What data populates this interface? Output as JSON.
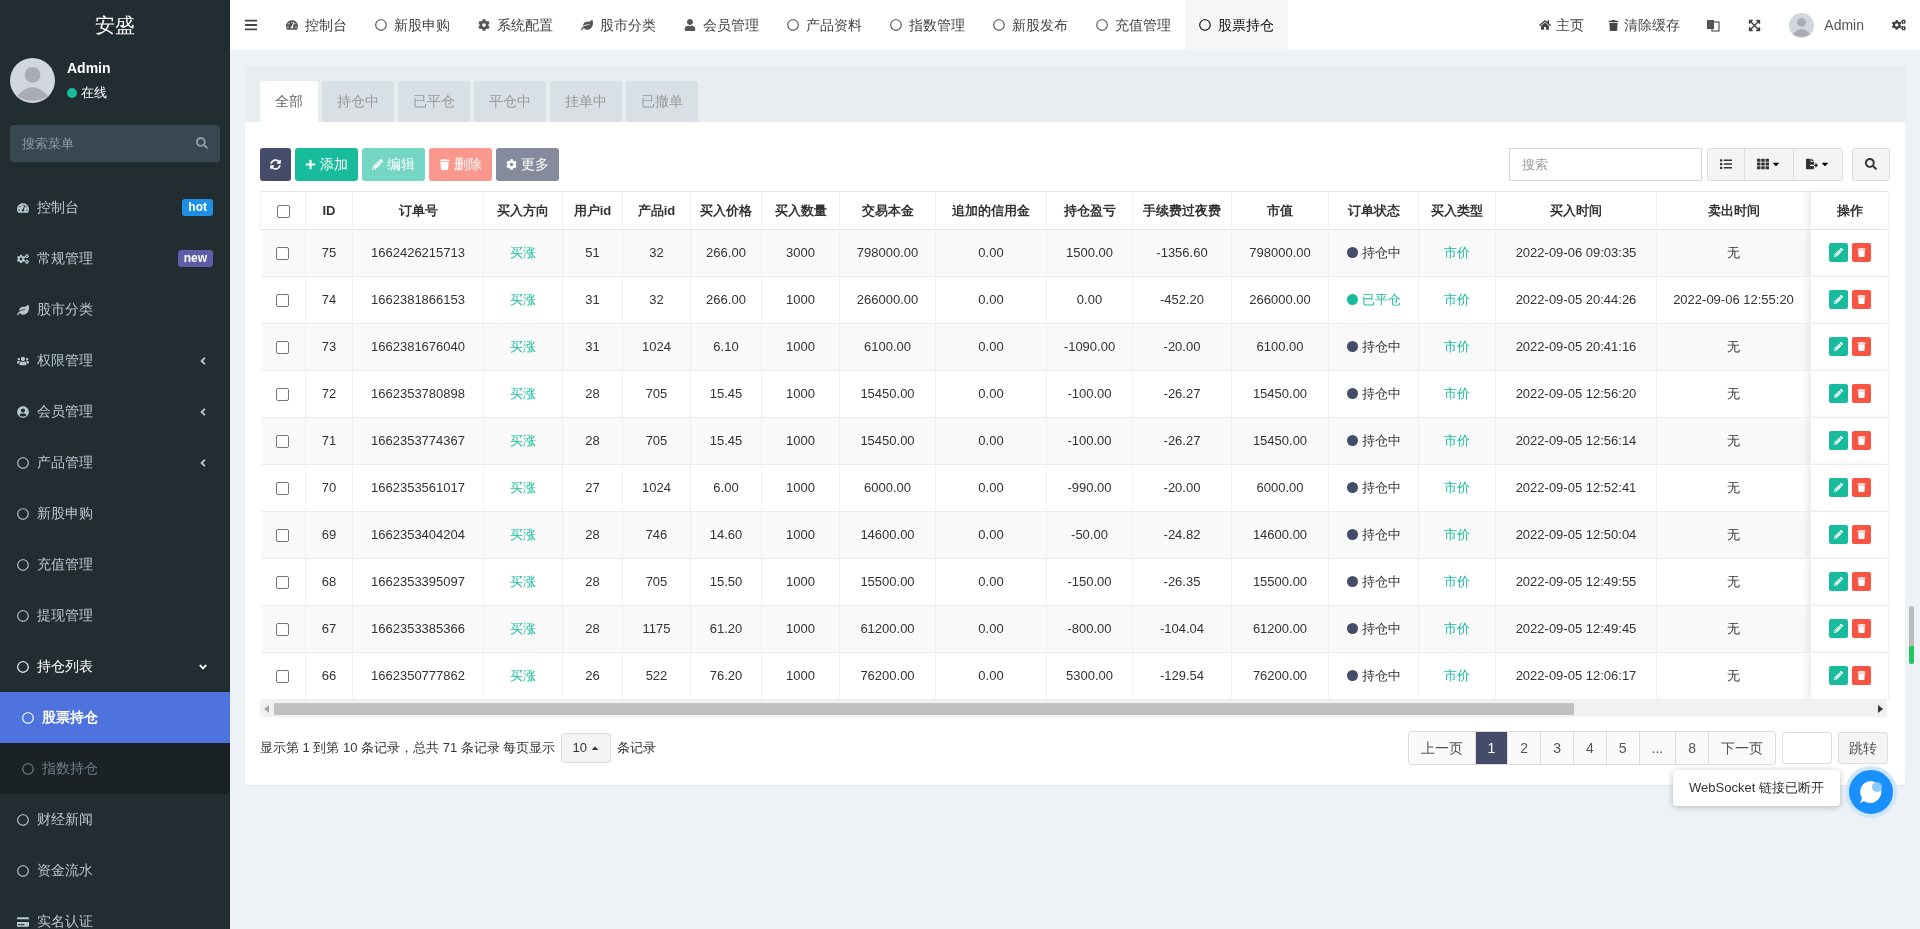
{
  "sidebar": {
    "logo": "安盛",
    "user": {
      "name": "Admin",
      "status": "在线"
    },
    "search": {
      "placeholder": "搜索菜单"
    },
    "items": [
      {
        "label": "控制台",
        "badge": {
          "label": "hot",
          "color": "#1e8fe6"
        },
        "selected": false
      },
      {
        "label": "常规管理",
        "badge": {
          "label": "new",
          "color": "#605ca8"
        },
        "selected": false
      },
      {
        "label": "股市分类",
        "selected": false
      },
      {
        "label": "权限管理",
        "expanded": false,
        "selected": false
      },
      {
        "label": "会员管理",
        "expanded": false,
        "selected": false
      },
      {
        "label": "产品管理",
        "expanded": false,
        "selected": false
      },
      {
        "label": "新股申购",
        "selected": false
      },
      {
        "label": "充值管理",
        "selected": false
      },
      {
        "label": "提现管理",
        "selected": false
      },
      {
        "label": "持仓列表",
        "expanded": true,
        "selected": false,
        "children": [
          {
            "label": "股票持仓",
            "selected": true
          },
          {
            "label": "指数持仓",
            "selected": false
          }
        ]
      },
      {
        "label": "财经新闻",
        "selected": false
      },
      {
        "label": "资金流水",
        "selected": false
      },
      {
        "label": "实名认证",
        "selected": false
      }
    ]
  },
  "topnav": {
    "tabs": [
      {
        "label": "控制台",
        "selected": false
      },
      {
        "label": "新股申购",
        "selected": false
      },
      {
        "label": "系统配置",
        "selected": false
      },
      {
        "label": "股市分类",
        "selected": false
      },
      {
        "label": "会员管理",
        "selected": false
      },
      {
        "label": "产品资料",
        "selected": false
      },
      {
        "label": "指数管理",
        "selected": false
      },
      {
        "label": "新股发布",
        "selected": false
      },
      {
        "label": "充值管理",
        "selected": false
      },
      {
        "label": "股票持仓",
        "selected": true
      }
    ],
    "links": [
      "主页",
      "清除缓存"
    ],
    "user": "Admin"
  },
  "filter_tabs": [
    {
      "label": "全部",
      "selected": true
    },
    {
      "label": "持仓中",
      "selected": false
    },
    {
      "label": "已平仓",
      "selected": false
    },
    {
      "label": "平仓中",
      "selected": false
    },
    {
      "label": "挂单中",
      "selected": false
    },
    {
      "label": "已撤单",
      "selected": false
    }
  ],
  "toolbar": {
    "buttons": [
      {
        "kind": "refresh",
        "disabled": false
      },
      {
        "kind": "add",
        "label": "添加",
        "disabled": false
      },
      {
        "kind": "edit",
        "label": "编辑",
        "disabled": true
      },
      {
        "kind": "delete",
        "label": "删除",
        "disabled": true
      },
      {
        "kind": "more",
        "label": "更多",
        "disabled": false
      }
    ],
    "search": {
      "placeholder": "搜索"
    }
  },
  "table": {
    "select_all": {
      "checked": false
    },
    "columns": [
      "ID",
      "订单号",
      "买入方向",
      "用户id",
      "产品id",
      "买入价格",
      "买入数量",
      "交易本金",
      "追加的信用金",
      "持仓盈亏",
      "手续费过夜费",
      "市值",
      "订单状态",
      "买入类型",
      "买入时间",
      "卖出时间",
      "操作"
    ],
    "rows": [
      {
        "checked": false,
        "cells": [
          "75",
          "1662426215713",
          "买涨",
          "51",
          "32",
          "266.00",
          "3000",
          "798000.00",
          "0.00",
          "1500.00",
          "-1356.60",
          "798000.00"
        ],
        "status": {
          "label": "持仓中",
          "color": "#444c69"
        },
        "buy_type": "市价",
        "buy_time": "2022-09-06 09:03:35",
        "sell_time": "无"
      },
      {
        "checked": false,
        "cells": [
          "74",
          "1662381866153",
          "买涨",
          "31",
          "32",
          "266.00",
          "1000",
          "266000.00",
          "0.00",
          "0.00",
          "-452.20",
          "266000.00"
        ],
        "status": {
          "label": "已平仓",
          "color": "#18bc9c"
        },
        "buy_type": "市价",
        "buy_time": "2022-09-05 20:44:26",
        "sell_time": "2022-09-06 12:55:20"
      },
      {
        "checked": false,
        "cells": [
          "73",
          "1662381676040",
          "买涨",
          "31",
          "1024",
          "6.10",
          "1000",
          "6100.00",
          "0.00",
          "-1090.00",
          "-20.00",
          "6100.00"
        ],
        "status": {
          "label": "持仓中",
          "color": "#444c69"
        },
        "buy_type": "市价",
        "buy_time": "2022-09-05 20:41:16",
        "sell_time": "无"
      },
      {
        "checked": false,
        "cells": [
          "72",
          "1662353780898",
          "买涨",
          "28",
          "705",
          "15.45",
          "1000",
          "15450.00",
          "0.00",
          "-100.00",
          "-26.27",
          "15450.00"
        ],
        "status": {
          "label": "持仓中",
          "color": "#444c69"
        },
        "buy_type": "市价",
        "buy_time": "2022-09-05 12:56:20",
        "sell_time": "无"
      },
      {
        "checked": false,
        "cells": [
          "71",
          "1662353774367",
          "买涨",
          "28",
          "705",
          "15.45",
          "1000",
          "15450.00",
          "0.00",
          "-100.00",
          "-26.27",
          "15450.00"
        ],
        "status": {
          "label": "持仓中",
          "color": "#444c69"
        },
        "buy_type": "市价",
        "buy_time": "2022-09-05 12:56:14",
        "sell_time": "无"
      },
      {
        "checked": false,
        "cells": [
          "70",
          "1662353561017",
          "买涨",
          "27",
          "1024",
          "6.00",
          "1000",
          "6000.00",
          "0.00",
          "-990.00",
          "-20.00",
          "6000.00"
        ],
        "status": {
          "label": "持仓中",
          "color": "#444c69"
        },
        "buy_type": "市价",
        "buy_time": "2022-09-05 12:52:41",
        "sell_time": "无"
      },
      {
        "checked": false,
        "cells": [
          "69",
          "1662353404204",
          "买涨",
          "28",
          "746",
          "14.60",
          "1000",
          "14600.00",
          "0.00",
          "-50.00",
          "-24.82",
          "14600.00"
        ],
        "status": {
          "label": "持仓中",
          "color": "#444c69"
        },
        "buy_type": "市价",
        "buy_time": "2022-09-05 12:50:04",
        "sell_time": "无"
      },
      {
        "checked": false,
        "cells": [
          "68",
          "1662353395097",
          "买涨",
          "28",
          "705",
          "15.50",
          "1000",
          "15500.00",
          "0.00",
          "-150.00",
          "-26.35",
          "15500.00"
        ],
        "status": {
          "label": "持仓中",
          "color": "#444c69"
        },
        "buy_type": "市价",
        "buy_time": "2022-09-05 12:49:55",
        "sell_time": "无"
      },
      {
        "checked": false,
        "cells": [
          "67",
          "1662353385366",
          "买涨",
          "28",
          "1175",
          "61.20",
          "1000",
          "61200.00",
          "0.00",
          "-800.00",
          "-104.04",
          "61200.00"
        ],
        "status": {
          "label": "持仓中",
          "color": "#444c69"
        },
        "buy_type": "市价",
        "buy_time": "2022-09-05 12:49:45",
        "sell_time": "无"
      },
      {
        "checked": false,
        "cells": [
          "66",
          "1662350777862",
          "买涨",
          "26",
          "522",
          "76.20",
          "1000",
          "76200.00",
          "0.00",
          "5300.00",
          "-129.54",
          "76200.00"
        ],
        "status": {
          "label": "持仓中",
          "color": "#444c69"
        },
        "buy_type": "市价",
        "buy_time": "2022-09-05 12:06:17",
        "sell_time": "无"
      }
    ]
  },
  "pagination": {
    "summary": "显示第 1 到第 10 条记录，总共 71 条记录 每页显示",
    "page_size": "10",
    "summary_after": "条记录",
    "prev": "上一页",
    "pages": [
      {
        "label": "1",
        "selected": true
      },
      {
        "label": "2",
        "selected": false
      },
      {
        "label": "3",
        "selected": false
      },
      {
        "label": "4",
        "selected": false
      },
      {
        "label": "5",
        "selected": false
      },
      {
        "label": "...",
        "selected": false
      },
      {
        "label": "8",
        "selected": false
      }
    ],
    "next": "下一页",
    "jump": "跳转"
  },
  "toast": "WebSocket 链接已断开"
}
